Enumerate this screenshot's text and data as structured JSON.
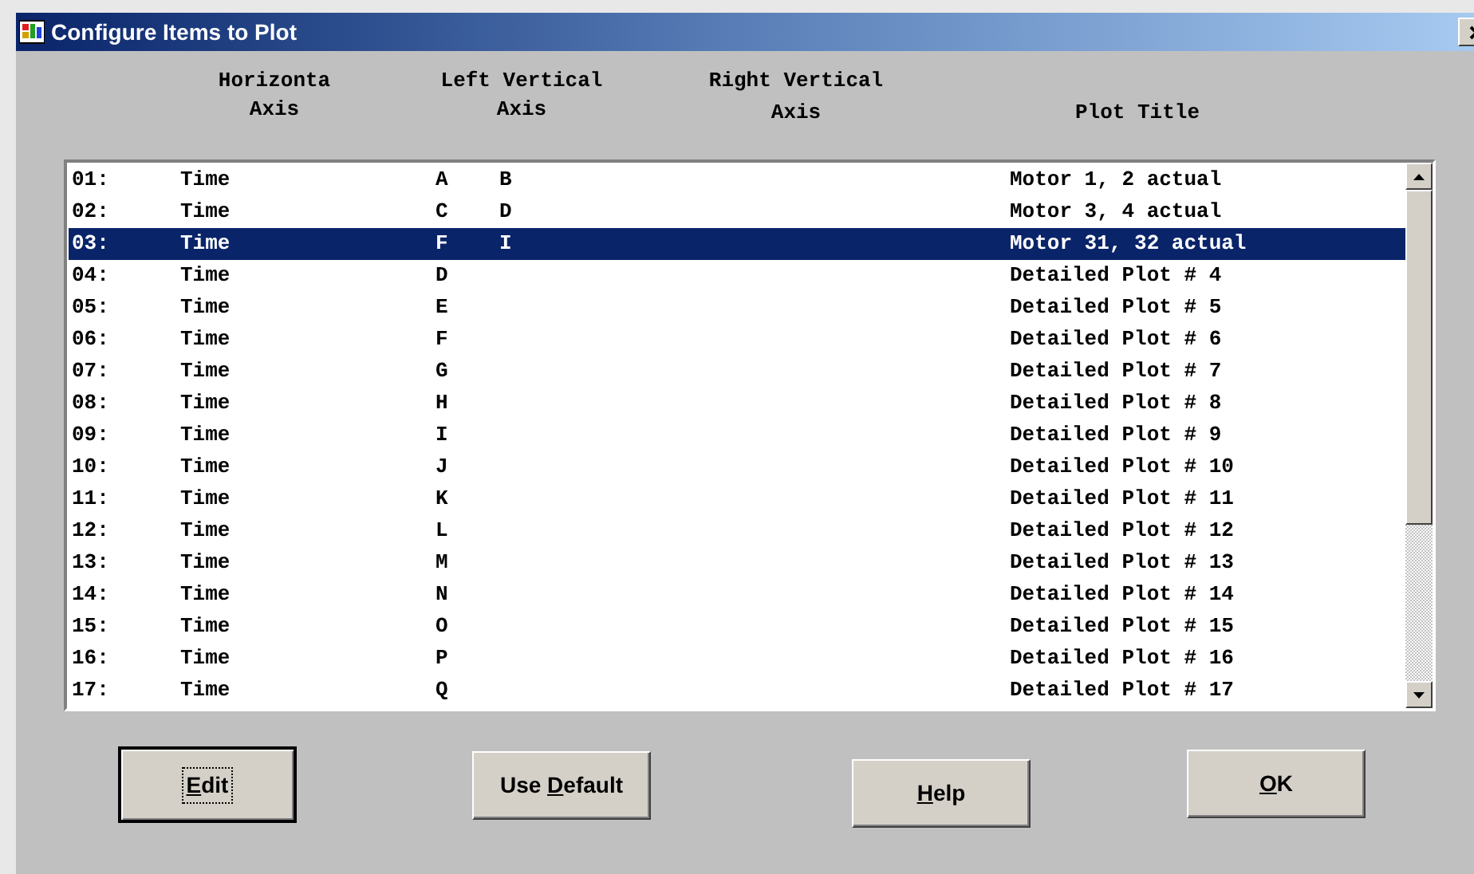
{
  "window": {
    "title": "Configure Items to Plot"
  },
  "headers": {
    "horizontal": [
      "Horizonta",
      "Axis"
    ],
    "left_vertical": [
      "Left Vertical",
      "Axis"
    ],
    "right_vertical": [
      "Right Vertical",
      "Axis"
    ],
    "plot_title": "Plot Title"
  },
  "rows": [
    {
      "number": "01:",
      "horizontal": "Time",
      "left_vertical": [
        "A",
        "B"
      ],
      "plot_title": "Motor 1, 2 actual",
      "selected": false
    },
    {
      "number": "02:",
      "horizontal": "Time",
      "left_vertical": [
        "C",
        "D"
      ],
      "plot_title": "Motor 3, 4 actual",
      "selected": false
    },
    {
      "number": "03:",
      "horizontal": "Time",
      "left_vertical": [
        "F",
        "I"
      ],
      "plot_title": "Motor 31, 32 actual",
      "selected": true
    },
    {
      "number": "04:",
      "horizontal": "Time",
      "left_vertical": [
        "D"
      ],
      "plot_title": "Detailed Plot # 4",
      "selected": false
    },
    {
      "number": "05:",
      "horizontal": "Time",
      "left_vertical": [
        "E"
      ],
      "plot_title": "Detailed Plot # 5",
      "selected": false
    },
    {
      "number": "06:",
      "horizontal": "Time",
      "left_vertical": [
        "F"
      ],
      "plot_title": "Detailed Plot # 6",
      "selected": false
    },
    {
      "number": "07:",
      "horizontal": "Time",
      "left_vertical": [
        "G"
      ],
      "plot_title": "Detailed Plot # 7",
      "selected": false
    },
    {
      "number": "08:",
      "horizontal": "Time",
      "left_vertical": [
        "H"
      ],
      "plot_title": "Detailed Plot # 8",
      "selected": false
    },
    {
      "number": "09:",
      "horizontal": "Time",
      "left_vertical": [
        "I"
      ],
      "plot_title": "Detailed Plot # 9",
      "selected": false
    },
    {
      "number": "10:",
      "horizontal": "Time",
      "left_vertical": [
        "J"
      ],
      "plot_title": "Detailed Plot # 10",
      "selected": false
    },
    {
      "number": "11:",
      "horizontal": "Time",
      "left_vertical": [
        "K"
      ],
      "plot_title": "Detailed Plot # 11",
      "selected": false
    },
    {
      "number": "12:",
      "horizontal": "Time",
      "left_vertical": [
        "L"
      ],
      "plot_title": "Detailed Plot # 12",
      "selected": false
    },
    {
      "number": "13:",
      "horizontal": "Time",
      "left_vertical": [
        "M"
      ],
      "plot_title": "Detailed Plot # 13",
      "selected": false
    },
    {
      "number": "14:",
      "horizontal": "Time",
      "left_vertical": [
        "N"
      ],
      "plot_title": "Detailed Plot # 14",
      "selected": false
    },
    {
      "number": "15:",
      "horizontal": "Time",
      "left_vertical": [
        "O"
      ],
      "plot_title": "Detailed Plot # 15",
      "selected": false
    },
    {
      "number": "16:",
      "horizontal": "Time",
      "left_vertical": [
        "P"
      ],
      "plot_title": "Detailed Plot # 16",
      "selected": false
    },
    {
      "number": "17:",
      "horizontal": "Time",
      "left_vertical": [
        "Q"
      ],
      "plot_title": "Detailed Plot # 17",
      "selected": false
    }
  ],
  "buttons": [
    {
      "key": "E",
      "after": "dit",
      "default": true
    },
    {
      "before": "Use ",
      "key": "D",
      "after": "efault",
      "default": false
    },
    {
      "key": "H",
      "after": "elp",
      "default": false
    },
    {
      "key": "O",
      "after": "K",
      "default": false
    }
  ]
}
